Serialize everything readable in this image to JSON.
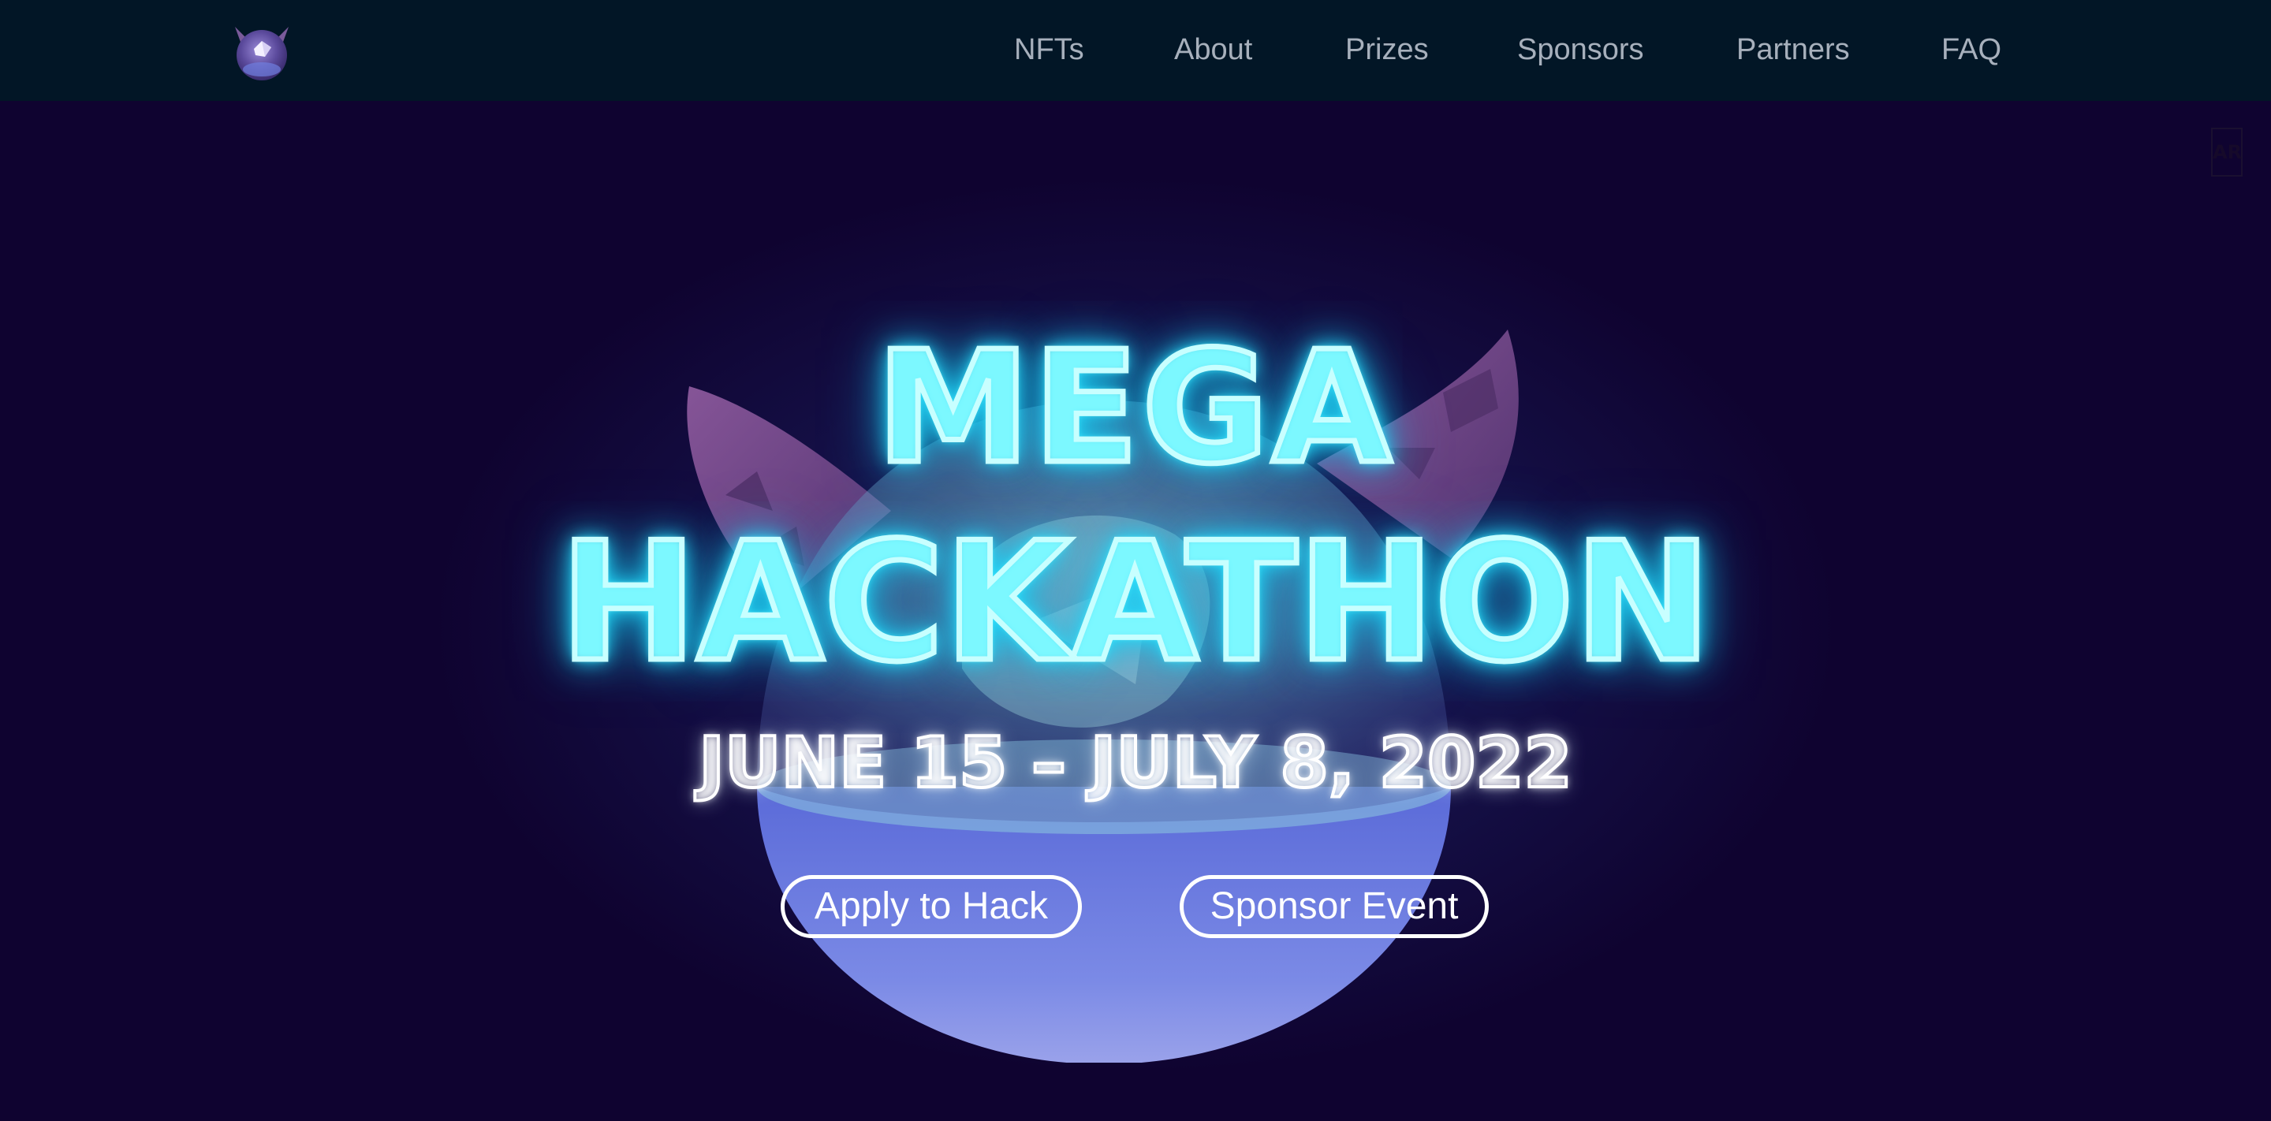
{
  "nav": {
    "logo_icon": "devil-orb-logo-icon",
    "links": [
      {
        "label": "NFTs"
      },
      {
        "label": "About"
      },
      {
        "label": "Prizes"
      },
      {
        "label": "Sponsors"
      },
      {
        "label": "Partners"
      },
      {
        "label": "FAQ"
      }
    ]
  },
  "hero": {
    "title_line1": "MEGA",
    "title_line2": "HACKATHON",
    "dates": "JUNE 15 – JULY 8, 2022",
    "apply_button": "Apply to Hack",
    "sponsor_button": "Sponsor Event",
    "mascot_icon": "devil-orb-mascot-icon"
  },
  "ar_badge": "AR",
  "colors": {
    "nav_background": "#021626",
    "page_background": "#0f0330",
    "neon_cyan": "#29e0ff",
    "nav_text": "#a7b0bc",
    "horn_purple": "#7a4a8c",
    "orb_blue": "#6f7fe0"
  }
}
